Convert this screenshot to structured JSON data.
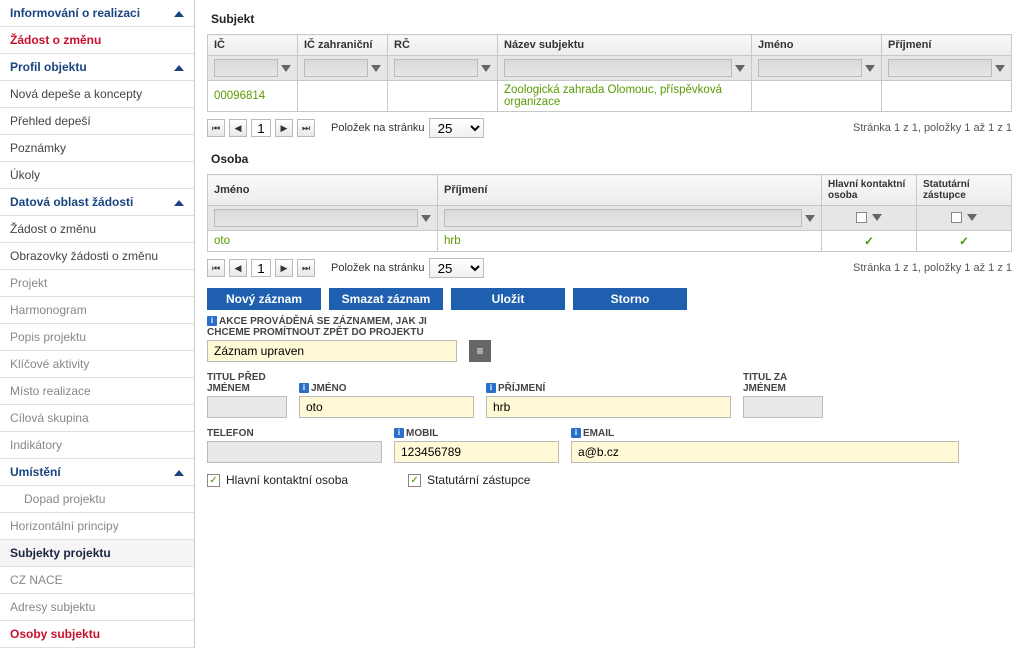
{
  "sidebar": {
    "items": [
      {
        "label": "Informování o realizaci",
        "cls": "header",
        "chev": true
      },
      {
        "label": "Žádost o změnu",
        "cls": "red"
      },
      {
        "label": "Profil objektu",
        "cls": "header",
        "chev": true
      },
      {
        "label": "Nová depeše a koncepty",
        "cls": ""
      },
      {
        "label": "Přehled depeší",
        "cls": ""
      },
      {
        "label": "Poznámky",
        "cls": ""
      },
      {
        "label": "Úkoly",
        "cls": ""
      },
      {
        "label": "Datová oblast žádosti",
        "cls": "header",
        "chev": true
      },
      {
        "label": "Žádost o změnu",
        "cls": ""
      },
      {
        "label": "Obrazovky žádosti o změnu",
        "cls": ""
      },
      {
        "label": "Projekt",
        "cls": "sub"
      },
      {
        "label": "Harmonogram",
        "cls": "sub"
      },
      {
        "label": "Popis projektu",
        "cls": "sub"
      },
      {
        "label": "Klíčové aktivity",
        "cls": "sub"
      },
      {
        "label": "Místo realizace",
        "cls": "sub"
      },
      {
        "label": "Cílová skupina",
        "cls": "sub"
      },
      {
        "label": "Indikátory",
        "cls": "sub"
      },
      {
        "label": "Umístění",
        "cls": "header",
        "chev": true
      },
      {
        "label": "Dopad projektu",
        "cls": "sub-indent"
      },
      {
        "label": "Horizontální principy",
        "cls": "sub"
      },
      {
        "label": "Subjekty projektu",
        "cls": "active"
      },
      {
        "label": "CZ NACE",
        "cls": "sub"
      },
      {
        "label": "Adresy subjektu",
        "cls": "sub"
      },
      {
        "label": "Osoby subjektu",
        "cls": "red"
      }
    ]
  },
  "subjekt": {
    "title": "Subjekt",
    "cols": [
      "IČ",
      "IČ zahraniční",
      "RČ",
      "Název subjektu",
      "Jméno",
      "Příjmení"
    ],
    "row": {
      "ic": "00096814",
      "nazev": "Zoologická zahrada Olomouc, příspěvková organizace"
    }
  },
  "osoba": {
    "title": "Osoba",
    "cols": [
      "Jméno",
      "Příjmení",
      "Hlavní kontaktní osoba",
      "Statutární zástupce"
    ],
    "row": {
      "jmeno": "oto",
      "prijmeni": "hrb"
    }
  },
  "pager": {
    "page": "1",
    "per_label": "Položek na stránku",
    "per_value": "25",
    "status": "Stránka 1 z 1, položky 1 až 1 z 1"
  },
  "actions": {
    "new": "Nový záznam",
    "delete": "Smazat záznam",
    "save": "Uložit",
    "cancel": "Storno"
  },
  "form": {
    "akce_label": "AKCE PROVÁDĚNÁ SE ZÁZNAMEM, JAK JI CHCEME PROMÍTNOUT ZPĚT DO PROJEKTU",
    "akce_value": "Záznam upraven",
    "titul_pred_label": "TITUL PŘED JMÉNEM",
    "jmeno_label": "JMÉNO",
    "jmeno_value": "oto",
    "prijmeni_label": "PŘÍJMENÍ",
    "prijmeni_value": "hrb",
    "titul_za_label": "TITUL ZA JMÉNEM",
    "telefon_label": "TELEFON",
    "mobil_label": "MOBIL",
    "mobil_value": "123456789",
    "email_label": "EMAIL",
    "email_value": "a@b.cz",
    "hlavni_label": "Hlavní kontaktní osoba",
    "statut_label": "Statutární zástupce"
  }
}
